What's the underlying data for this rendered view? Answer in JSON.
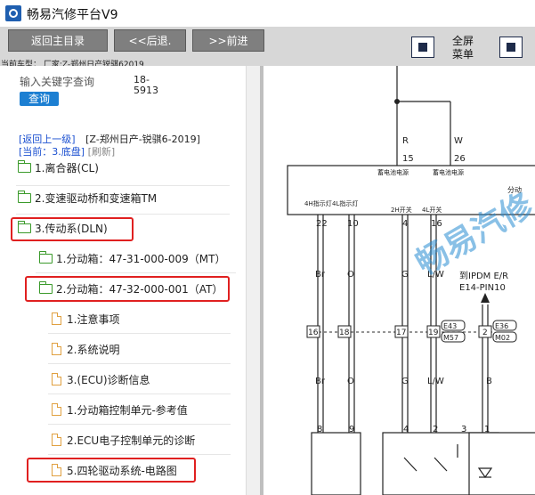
{
  "app": {
    "title": "畅易汽修平台V9"
  },
  "toolbar": {
    "home_label": "返回主目录",
    "back_label": "<<后退.",
    "forward_label": ">>前进",
    "fullscreen_line1": "全屏",
    "fullscreen_line2": "菜单",
    "model_label": "当前车型： 厂家:Z-郑州日产锐骐62019"
  },
  "search": {
    "placeholder": "输入关键字查询",
    "button_label": "查询",
    "code_line1": "18-",
    "code_line2": "5913"
  },
  "nav": {
    "back_link": "[返回上一级]",
    "path": "[Z-郑州日产-锐骐6-2019]",
    "current": "[当前：3.底盘]",
    "refresh": "[刷新]"
  },
  "tree": [
    {
      "label": "1.离合器(CL)",
      "type": "folder"
    },
    {
      "label": "2.变速驱动桥和变速箱TM",
      "type": "folder"
    },
    {
      "label": "3.传动系(DLN)",
      "type": "folder-open"
    },
    {
      "label": "1.分动箱：47-31-000-009（MT）",
      "type": "folder"
    },
    {
      "label": "2.分动箱：47-32-000-001（AT）",
      "type": "folder-open"
    },
    {
      "label": "1.注意事项",
      "type": "doc"
    },
    {
      "label": "2.系统说明",
      "type": "doc"
    },
    {
      "label": "3.(ECU)诊断信息",
      "type": "doc"
    },
    {
      "label": "1.分动箱控制单元-参考值",
      "type": "doc"
    },
    {
      "label": "2.ECU电子控制单元的诊断",
      "type": "doc"
    },
    {
      "label": "5.四轮驱动系统-电路图",
      "type": "doc"
    }
  ],
  "diagram": {
    "wire_top_left": "R",
    "wire_top_right": "W",
    "pin_top_left": "15",
    "pin_top_right": "26",
    "box_label_left": "蓄电池电源",
    "box_label_right": "蓄电池电源",
    "box_label_far": "分动",
    "pin_labels": [
      "4H指示灯",
      "4L指示灯",
      "2H开关",
      "4L开关"
    ],
    "pins": [
      "22",
      "10",
      "4",
      "16"
    ],
    "wire_colors_mid": [
      "Br",
      "O",
      "G",
      "L/W"
    ],
    "connector_pins": [
      "16",
      "18",
      "17",
      "19",
      "2"
    ],
    "connector_codes": [
      "E43",
      "M57",
      "E36",
      "M02"
    ],
    "ipdm_line1": "到IPDM E/R",
    "ipdm_line2": "E14-PIN10",
    "wire_colors_low": [
      "Br",
      "O",
      "G",
      "L/W",
      "B"
    ],
    "bottom_pins": [
      "8",
      "9",
      "4",
      "2",
      "3",
      "1"
    ],
    "watermark": "畅易汽修"
  }
}
